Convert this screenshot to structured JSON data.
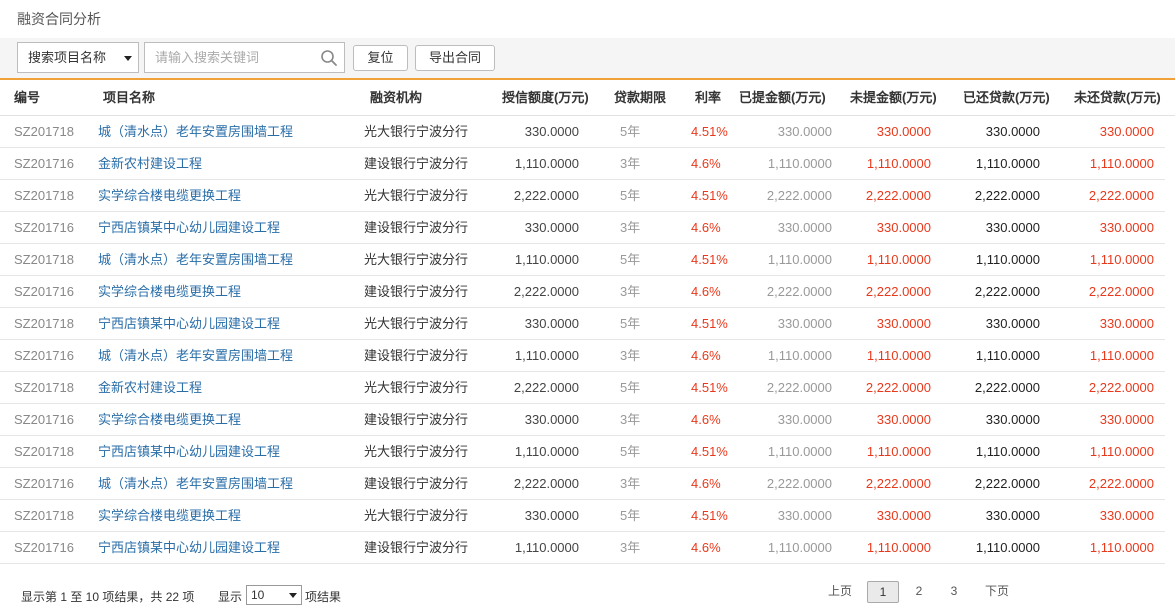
{
  "page": {
    "title": "融资合同分析"
  },
  "toolbar": {
    "search_type": "搜索项目名称",
    "search_placeholder": "请输入搜索关键词",
    "reset_label": "复位",
    "export_label": "导出合同"
  },
  "table": {
    "headers": {
      "code": "编号",
      "name": "项目名称",
      "org": "融资机构",
      "credit": "授信额度(万元)",
      "term": "贷款期限",
      "rate": "利率",
      "drawn": "已提金额(万元)",
      "undrawn": "未提金额(万元)",
      "repaid": "已还贷款(万元)",
      "unpaid": "未还贷款(万元)"
    },
    "rows": [
      {
        "code": "SZ201718",
        "name": "城（清水点）老年安置房围墙工程",
        "org": "光大银行宁波分行",
        "credit": "330.0000",
        "term": "5年",
        "rate": "4.51%",
        "drawn": "330.0000",
        "undrawn": "330.0000",
        "repaid": "330.0000",
        "unpaid": "330.0000"
      },
      {
        "code": "SZ201716",
        "name": "金新农村建设工程",
        "org": "建设银行宁波分行",
        "credit": "1,110.0000",
        "term": "3年",
        "rate": "4.6%",
        "drawn": "1,110.0000",
        "undrawn": "1,110.0000",
        "repaid": "1,110.0000",
        "unpaid": "1,110.0000"
      },
      {
        "code": "SZ201718",
        "name": "实学综合楼电缆更换工程",
        "org": "光大银行宁波分行",
        "credit": "2,222.0000",
        "term": "5年",
        "rate": "4.51%",
        "drawn": "2,222.0000",
        "undrawn": "2,222.0000",
        "repaid": "2,222.0000",
        "unpaid": "2,222.0000"
      },
      {
        "code": "SZ201716",
        "name": "宁西店镇某中心幼儿园建设工程",
        "org": "建设银行宁波分行",
        "credit": "330.0000",
        "term": "3年",
        "rate": "4.6%",
        "drawn": "330.0000",
        "undrawn": "330.0000",
        "repaid": "330.0000",
        "unpaid": "330.0000"
      },
      {
        "code": "SZ201718",
        "name": "城（清水点）老年安置房围墙工程",
        "org": "光大银行宁波分行",
        "credit": "1,110.0000",
        "term": "5年",
        "rate": "4.51%",
        "drawn": "1,110.0000",
        "undrawn": "1,110.0000",
        "repaid": "1,110.0000",
        "unpaid": "1,110.0000"
      },
      {
        "code": "SZ201716",
        "name": "实学综合楼电缆更换工程",
        "org": "建设银行宁波分行",
        "credit": "2,222.0000",
        "term": "3年",
        "rate": "4.6%",
        "drawn": "2,222.0000",
        "undrawn": "2,222.0000",
        "repaid": "2,222.0000",
        "unpaid": "2,222.0000"
      },
      {
        "code": "SZ201718",
        "name": "宁西店镇某中心幼儿园建设工程",
        "org": "光大银行宁波分行",
        "credit": "330.0000",
        "term": "5年",
        "rate": "4.51%",
        "drawn": "330.0000",
        "undrawn": "330.0000",
        "repaid": "330.0000",
        "unpaid": "330.0000"
      },
      {
        "code": "SZ201716",
        "name": "城（清水点）老年安置房围墙工程",
        "org": "建设银行宁波分行",
        "credit": "1,110.0000",
        "term": "3年",
        "rate": "4.6%",
        "drawn": "1,110.0000",
        "undrawn": "1,110.0000",
        "repaid": "1,110.0000",
        "unpaid": "1,110.0000"
      },
      {
        "code": "SZ201718",
        "name": "金新农村建设工程",
        "org": "光大银行宁波分行",
        "credit": "2,222.0000",
        "term": "5年",
        "rate": "4.51%",
        "drawn": "2,222.0000",
        "undrawn": "2,222.0000",
        "repaid": "2,222.0000",
        "unpaid": "2,222.0000"
      },
      {
        "code": "SZ201716",
        "name": "实学综合楼电缆更换工程",
        "org": "建设银行宁波分行",
        "credit": "330.0000",
        "term": "3年",
        "rate": "4.6%",
        "drawn": "330.0000",
        "undrawn": "330.0000",
        "repaid": "330.0000",
        "unpaid": "330.0000"
      },
      {
        "code": "SZ201718",
        "name": "宁西店镇某中心幼儿园建设工程",
        "org": "光大银行宁波分行",
        "credit": "1,110.0000",
        "term": "5年",
        "rate": "4.51%",
        "drawn": "1,110.0000",
        "undrawn": "1,110.0000",
        "repaid": "1,110.0000",
        "unpaid": "1,110.0000"
      },
      {
        "code": "SZ201716",
        "name": "城（清水点）老年安置房围墙工程",
        "org": "建设银行宁波分行",
        "credit": "2,222.0000",
        "term": "3年",
        "rate": "4.6%",
        "drawn": "2,222.0000",
        "undrawn": "2,222.0000",
        "repaid": "2,222.0000",
        "unpaid": "2,222.0000"
      },
      {
        "code": "SZ201718",
        "name": "实学综合楼电缆更换工程",
        "org": "光大银行宁波分行",
        "credit": "330.0000",
        "term": "5年",
        "rate": "4.51%",
        "drawn": "330.0000",
        "undrawn": "330.0000",
        "repaid": "330.0000",
        "unpaid": "330.0000"
      },
      {
        "code": "SZ201716",
        "name": "宁西店镇某中心幼儿园建设工程",
        "org": "建设银行宁波分行",
        "credit": "1,110.0000",
        "term": "3年",
        "rate": "4.6%",
        "drawn": "1,110.0000",
        "undrawn": "1,110.0000",
        "repaid": "1,110.0000",
        "unpaid": "1,110.0000"
      }
    ]
  },
  "footer": {
    "info": "显示第 1 至 10 项结果，共 22 项",
    "show_label": "显示",
    "page_size": "10",
    "result_label": "项结果",
    "prev": "上页",
    "pages": [
      "1",
      "2",
      "3"
    ],
    "next": "下页"
  },
  "colors": {
    "accent": "#f0a13a",
    "link": "#2a6ea8",
    "red": "#e8391c"
  }
}
